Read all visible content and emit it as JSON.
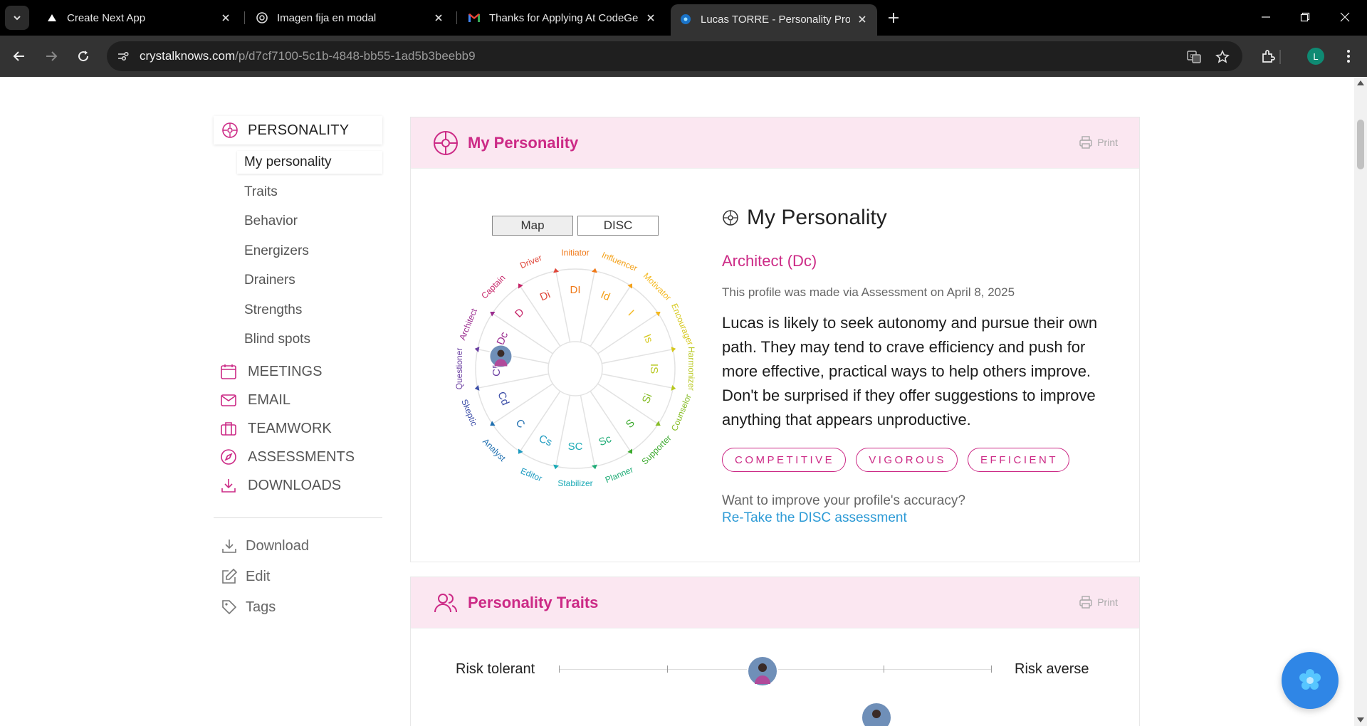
{
  "browser": {
    "tabs": [
      {
        "title": "Create Next App",
        "icon": "triangle-icon"
      },
      {
        "title": "Imagen fija en modal",
        "icon": "chatgpt-icon"
      },
      {
        "title": "Thanks for Applying At CodeGe",
        "icon": "gmail-icon"
      },
      {
        "title": "Lucas TORRE - Personality Profil",
        "icon": "crystal-icon",
        "active": true
      }
    ],
    "url_host": "crystalknows.com",
    "url_path": "/p/d7cf7100-5c1b-4848-bb55-1ad5b3beebb9",
    "profile_initial": "L"
  },
  "sidebar": {
    "header": "PERSONALITY",
    "sub_items": [
      "My personality",
      "Traits",
      "Behavior",
      "Energizers",
      "Drainers",
      "Strengths",
      "Blind spots"
    ],
    "sections": [
      {
        "label": "MEETINGS",
        "icon": "calendar-icon"
      },
      {
        "label": "EMAIL",
        "icon": "envelope-icon"
      },
      {
        "label": "TEAMWORK",
        "icon": "briefcase-icon"
      },
      {
        "label": "ASSESSMENTS",
        "icon": "compass-icon"
      },
      {
        "label": "DOWNLOADS",
        "icon": "download-icon"
      }
    ],
    "actions": [
      {
        "label": "Download",
        "icon": "download-icon"
      },
      {
        "label": "Edit",
        "icon": "edit-icon"
      },
      {
        "label": "Tags",
        "icon": "tag-icon"
      }
    ]
  },
  "personality_card": {
    "title": "My Personality",
    "print": "Print",
    "toggle": {
      "map": "Map",
      "disc": "DISC",
      "selected": "Map"
    },
    "heading": "My Personality",
    "archetype": "Architect (Dc)",
    "made_via": "This profile was made via Assessment on April 8, 2025",
    "description": "Lucas is likely to seek autonomy and pursue their own path. They may tend to crave efficiency and push for more effective, practical ways to help others improve. Don't be surprised if they offer suggestions to improve anything that appears unproductive.",
    "traits": [
      "COMPETITIVE",
      "VIGOROUS",
      "EFFICIENT"
    ],
    "improve_prompt": "Want to improve your profile's accuracy?",
    "retake_link": "Re-Take the DISC assessment",
    "wheel": {
      "selected": "Dc",
      "segments": [
        {
          "code": "DI",
          "name": "Initiator",
          "color": "#f07a1a"
        },
        {
          "code": "Id",
          "name": "Influencer",
          "color": "#f4a21b"
        },
        {
          "code": "I",
          "name": "Motivator",
          "color": "#f4b81f"
        },
        {
          "code": "Is",
          "name": "Encourager",
          "color": "#d6c81d"
        },
        {
          "code": "IS",
          "name": "Harmonizer",
          "color": "#b8c820"
        },
        {
          "code": "Si",
          "name": "Counselor",
          "color": "#86bd27"
        },
        {
          "code": "S",
          "name": "Supporter",
          "color": "#3caa2e"
        },
        {
          "code": "Sc",
          "name": "Planner",
          "color": "#22ad78"
        },
        {
          "code": "SC",
          "name": "Stabilizer",
          "color": "#19a9b5"
        },
        {
          "code": "Cs",
          "name": "Editor",
          "color": "#1c9ac0"
        },
        {
          "code": "C",
          "name": "Analyst",
          "color": "#1f6fb0"
        },
        {
          "code": "Cd",
          "name": "Skeptic",
          "color": "#3d4fa8"
        },
        {
          "code": "CD",
          "name": "Questioner",
          "color": "#6a3ea1"
        },
        {
          "code": "Dc",
          "name": "Architect",
          "color": "#9b2d8f"
        },
        {
          "code": "D",
          "name": "Captain",
          "color": "#c62468"
        },
        {
          "code": "Di",
          "name": "Driver",
          "color": "#e0483b"
        }
      ]
    }
  },
  "traits_card": {
    "title": "Personality Traits",
    "print": "Print",
    "scale_left": "Risk tolerant",
    "scale_right": "Risk averse"
  },
  "colors": {
    "accent": "#cc2a86",
    "link": "#2e9bd6",
    "header_bg": "#fbe7f1"
  }
}
